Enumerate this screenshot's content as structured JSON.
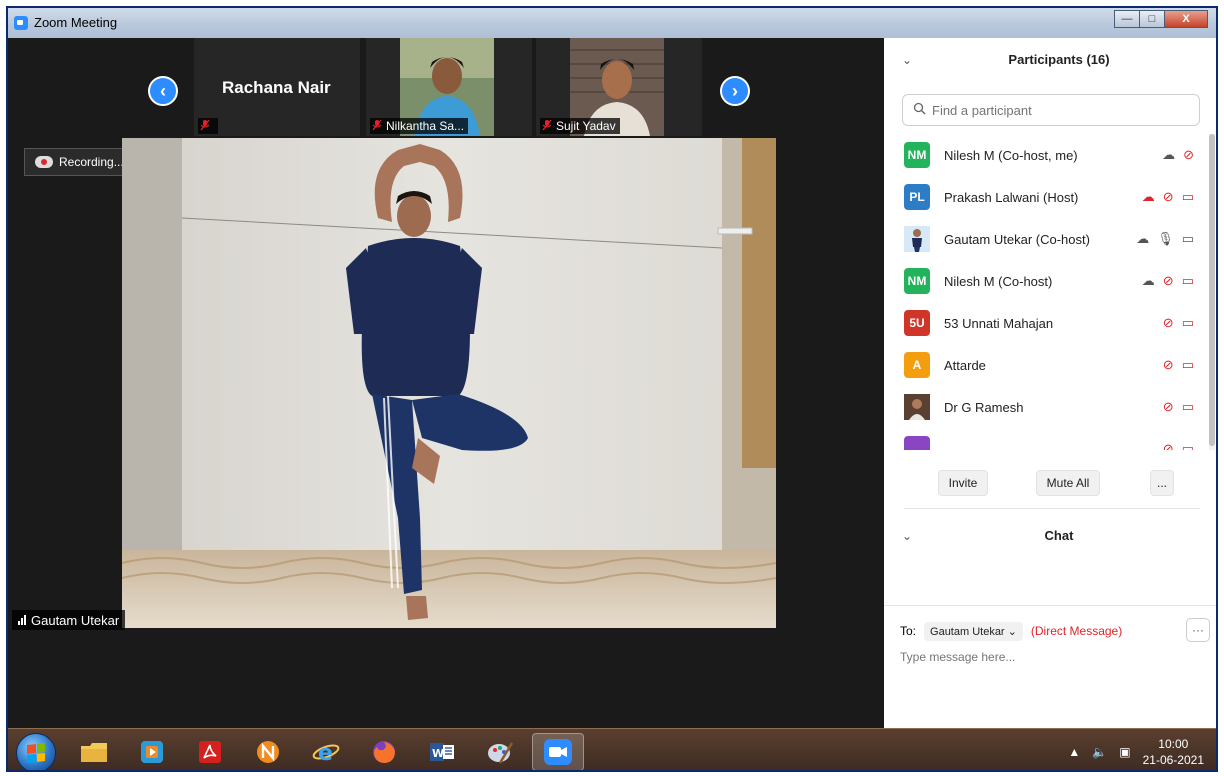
{
  "window": {
    "title": "Zoom Meeting",
    "minimize_glyph": "—",
    "maximize_glyph": "□",
    "close_glyph": "X"
  },
  "video_strip": {
    "prev_glyph": "‹",
    "next_glyph": "›",
    "tiles": [
      {
        "name": "Rachana Nair",
        "label": ""
      },
      {
        "name": "Nilkantha Sa...",
        "label": "Nilkantha Sa..."
      },
      {
        "name": "Sujit Yadav",
        "label": "Sujit Yadav"
      }
    ]
  },
  "recording": {
    "label": "Recording..."
  },
  "main_video": {
    "speaker_label": "Gautam Utekar"
  },
  "participants_panel": {
    "title": "Participants (16)",
    "search_placeholder": "Find a participant",
    "participants": [
      {
        "avatar": "NM",
        "avatar_color": "#23b35a",
        "name": "Nilesh M (Co-host, me)",
        "icons": [
          "cloud-record-icon",
          "mic-muted-icon"
        ]
      },
      {
        "avatar": "PL",
        "avatar_color": "#2d7dc6",
        "name": "Prakash Lalwani (Host)",
        "icons": [
          "cloud-record-icon",
          "mic-muted-icon",
          "video-off-icon"
        ]
      },
      {
        "avatar": "",
        "avatar_color": "#d7e9f7",
        "name": "Gautam Utekar (Co-host)",
        "icons": [
          "cloud-record-icon",
          "mic-on-icon",
          "video-on-icon"
        ]
      },
      {
        "avatar": "NM",
        "avatar_color": "#23b35a",
        "name": "Nilesh M (Co-host)",
        "icons": [
          "cloud-record-icon",
          "mic-muted-icon",
          "video-off-icon"
        ]
      },
      {
        "avatar": "5U",
        "avatar_color": "#d0352a",
        "name": "53 Unnati Mahajan",
        "icons": [
          "mic-muted-icon",
          "video-off-icon"
        ]
      },
      {
        "avatar": "A",
        "avatar_color": "#f49d0f",
        "name": "Attarde",
        "icons": [
          "mic-muted-icon",
          "video-off-icon"
        ]
      },
      {
        "avatar": "",
        "avatar_color": "#6a4c3d",
        "name": "Dr G Ramesh",
        "icons": [
          "mic-muted-icon",
          "video-off-icon"
        ]
      },
      {
        "avatar": "",
        "avatar_color": "#8a45c2",
        "name": "",
        "icons": [
          "mic-muted-icon",
          "video-off-icon"
        ]
      }
    ],
    "buttons": {
      "invite": "Invite",
      "mute_all": "Mute All",
      "more": "..."
    }
  },
  "chat_panel": {
    "title": "Chat",
    "to_label": "To:",
    "recipient": "Gautam Utekar ⌄",
    "direct_label": "(Direct Message)",
    "more": "···",
    "input_placeholder": "Type message here..."
  },
  "taskbar": {
    "apps": [
      "windows-explorer",
      "media-player",
      "adobe-reader",
      "app-n",
      "internet-explorer",
      "firefox",
      "word",
      "paint",
      "zoom"
    ],
    "time": "10:00",
    "date": "21-06-2021"
  }
}
